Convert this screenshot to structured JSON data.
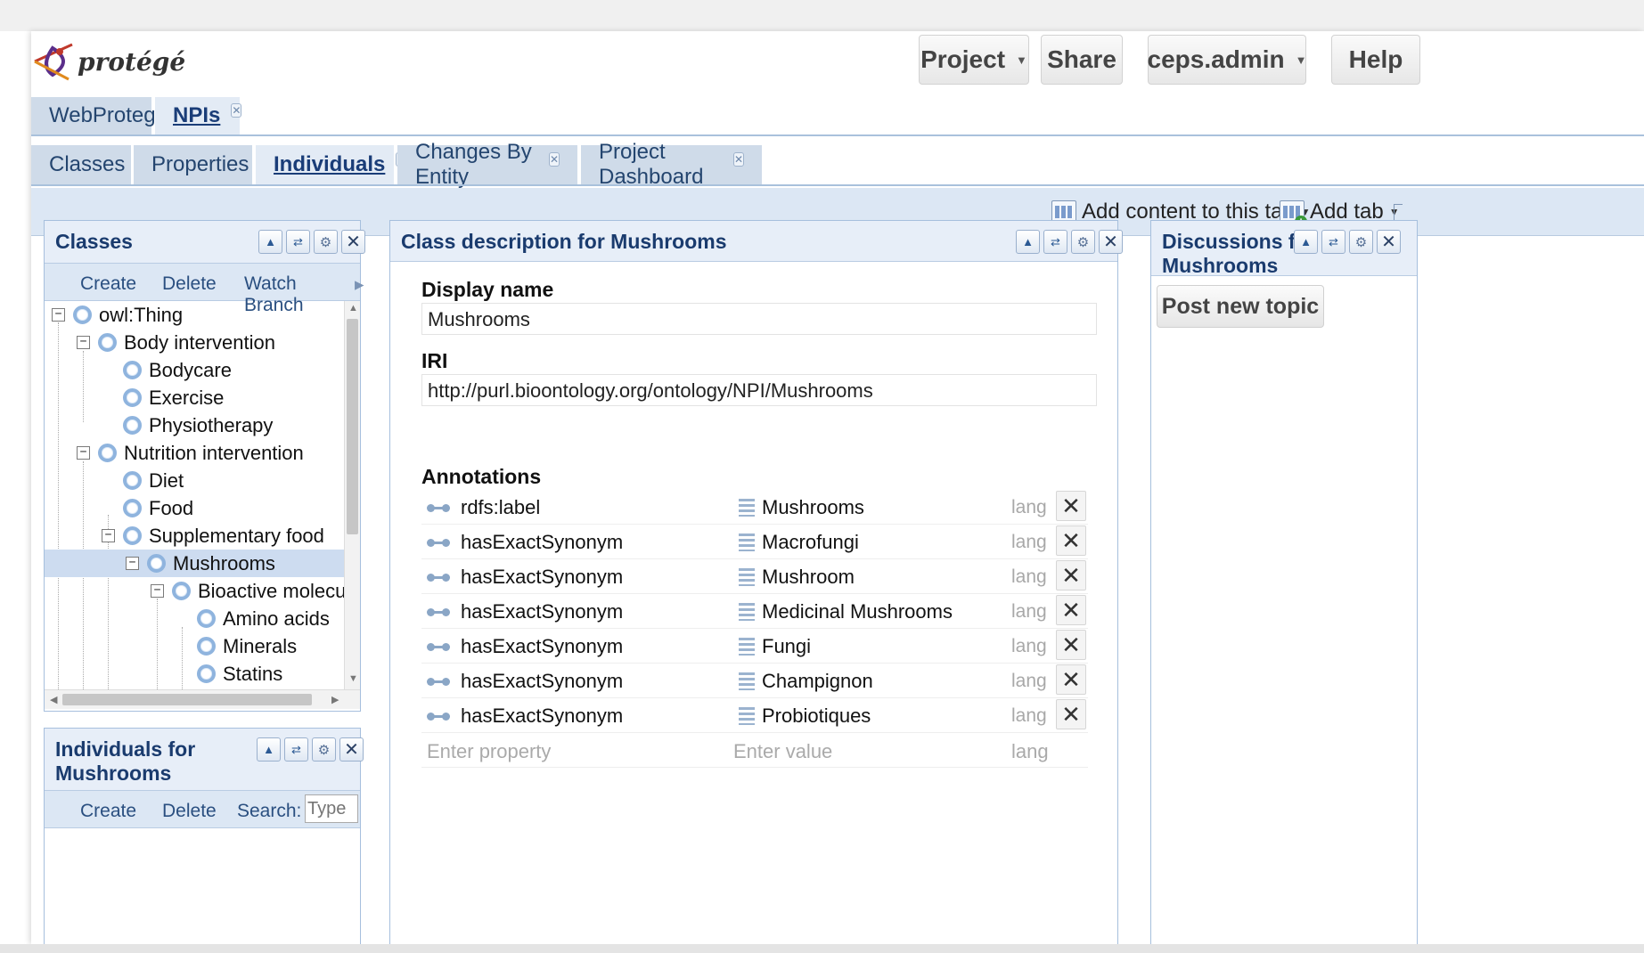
{
  "app": {
    "logo_text": "protégé"
  },
  "header": {
    "project_label": "Project",
    "share_label": "Share",
    "user_label": "ceps.admin",
    "help_label": "Help"
  },
  "project_tabs": [
    {
      "label": "WebProtege",
      "closable": false,
      "active": false
    },
    {
      "label": "NPIs",
      "closable": true,
      "active": true
    }
  ],
  "view_tabs": [
    {
      "label": "Classes"
    },
    {
      "label": "Properties"
    },
    {
      "label": "Individuals",
      "active": true
    },
    {
      "label": "Changes By Entity"
    },
    {
      "label": "Project Dashboard"
    }
  ],
  "tab_toolbar": {
    "add_content_label": "Add content to this tab",
    "add_tab_label": "Add tab"
  },
  "classes_portlet": {
    "title": "Classes",
    "toolbar": {
      "create": "Create",
      "delete": "Delete",
      "watch_branch": "Watch Branch"
    },
    "tree": [
      {
        "label": "owl:Thing",
        "expanded": true
      },
      {
        "label": "Body intervention",
        "expanded": true
      },
      {
        "label": "Bodycare"
      },
      {
        "label": "Exercise"
      },
      {
        "label": "Physiotherapy"
      },
      {
        "label": "Nutrition intervention",
        "expanded": true
      },
      {
        "label": "Diet"
      },
      {
        "label": "Food"
      },
      {
        "label": "Supplementary food",
        "expanded": true
      },
      {
        "label": "Mushrooms",
        "expanded": true,
        "selected": true
      },
      {
        "label": "Bioactive molecules",
        "expanded": true
      },
      {
        "label": "Amino acids"
      },
      {
        "label": "Minerals"
      },
      {
        "label": "Statins"
      }
    ]
  },
  "individuals_portlet": {
    "title_line1": "Individuals for",
    "title_line2": "Mushrooms",
    "toolbar": {
      "create": "Create",
      "delete": "Delete",
      "search": "Search:",
      "search_placeholder": "Type"
    }
  },
  "description_portlet": {
    "title": "Class description for Mushrooms",
    "display_name_label": "Display name",
    "display_name_value": "Mushrooms",
    "iri_label": "IRI",
    "iri_value": "http://purl.bioontology.org/ontology/NPI/Mushrooms",
    "annotations_label": "Annotations",
    "annotations": [
      {
        "property": "rdfs:label",
        "value": "Mushrooms",
        "lang": "lang"
      },
      {
        "property": "hasExactSynonym",
        "value": "Macrofungi",
        "lang": "lang"
      },
      {
        "property": "hasExactSynonym",
        "value": "Mushroom",
        "lang": "lang"
      },
      {
        "property": "hasExactSynonym",
        "value": "Medicinal Mushrooms",
        "lang": "lang"
      },
      {
        "property": "hasExactSynonym",
        "value": "Fungi",
        "lang": "lang"
      },
      {
        "property": "hasExactSynonym",
        "value": "Champignon",
        "lang": "lang"
      },
      {
        "property": "hasExactSynonym",
        "value": "Probiotiques",
        "lang": "lang"
      }
    ],
    "new_row": {
      "property_placeholder": "Enter property",
      "value_placeholder": "Enter value",
      "lang_placeholder": "lang"
    }
  },
  "discussions_portlet": {
    "title_line1": "Discussions for",
    "title_line2": "Mushrooms",
    "post_label": "Post new topic"
  },
  "colors": {
    "accent": "#1a3b6e",
    "tab_bg": "#cfdbe9",
    "toolbar_bg": "#dce7f4",
    "selection": "#cddcf0"
  },
  "icons": {
    "logo": "protege-logo-icon",
    "class": "class-circle-icon",
    "property": "annotation-property-icon",
    "value": "literal-value-icon",
    "delete": "close-icon"
  }
}
